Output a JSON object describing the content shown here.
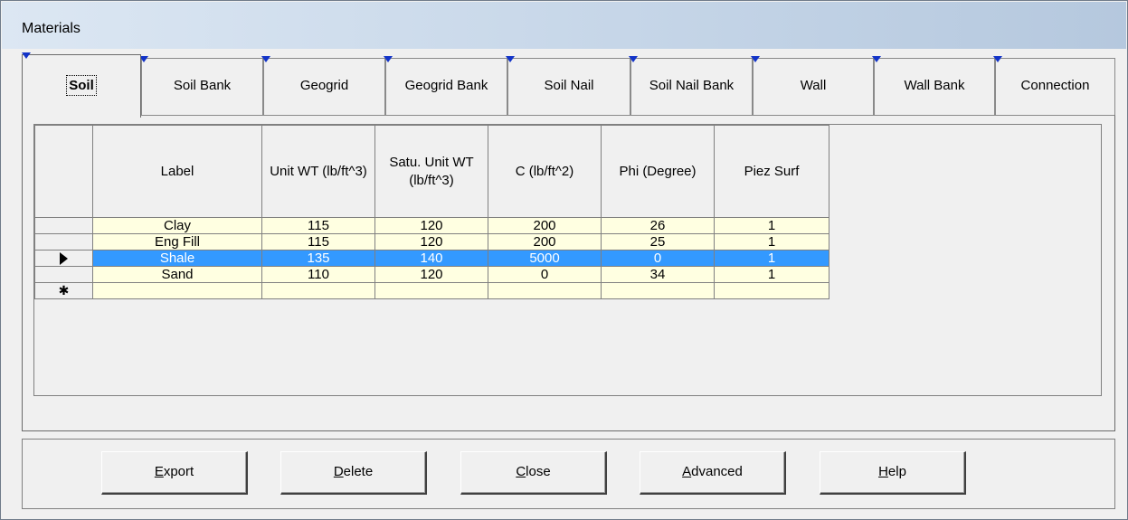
{
  "window": {
    "title": "Materials"
  },
  "tabs": [
    {
      "label": "Soil",
      "active": true
    },
    {
      "label": "Soil Bank"
    },
    {
      "label": "Geogrid"
    },
    {
      "label": "Geogrid Bank"
    },
    {
      "label": "Soil Nail"
    },
    {
      "label": "Soil Nail Bank"
    },
    {
      "label": "Wall"
    },
    {
      "label": "Wall Bank"
    },
    {
      "label": "Connection"
    }
  ],
  "grid": {
    "columns": [
      "Label",
      "Unit WT (lb/ft^3)",
      "Satu. Unit WT (lb/ft^3)",
      "C (lb/ft^2)",
      "Phi (Degree)",
      "Piez Surf"
    ],
    "rows": [
      [
        "Clay",
        "115",
        "120",
        "200",
        "26",
        "1"
      ],
      [
        "Eng Fill",
        "115",
        "120",
        "200",
        "25",
        "1"
      ],
      [
        "Shale",
        "135",
        "140",
        "5000",
        "0",
        "1"
      ],
      [
        "Sand",
        "110",
        "120",
        "0",
        "34",
        "1"
      ],
      [
        "",
        "",
        "",
        "",
        "",
        ""
      ]
    ],
    "selected_row": 2,
    "new_row_glyph": "✱",
    "selection_color": "#3399ff",
    "cell_background": "#ffffe1"
  },
  "buttons": {
    "export": {
      "mnemonic": "E",
      "rest": "xport"
    },
    "delete": {
      "mnemonic": "D",
      "rest": "elete"
    },
    "close": {
      "mnemonic": "C",
      "rest": "lose"
    },
    "advanced": {
      "mnemonic": "A",
      "rest": "dvanced"
    },
    "help": {
      "mnemonic": "H",
      "rest": "elp"
    }
  }
}
